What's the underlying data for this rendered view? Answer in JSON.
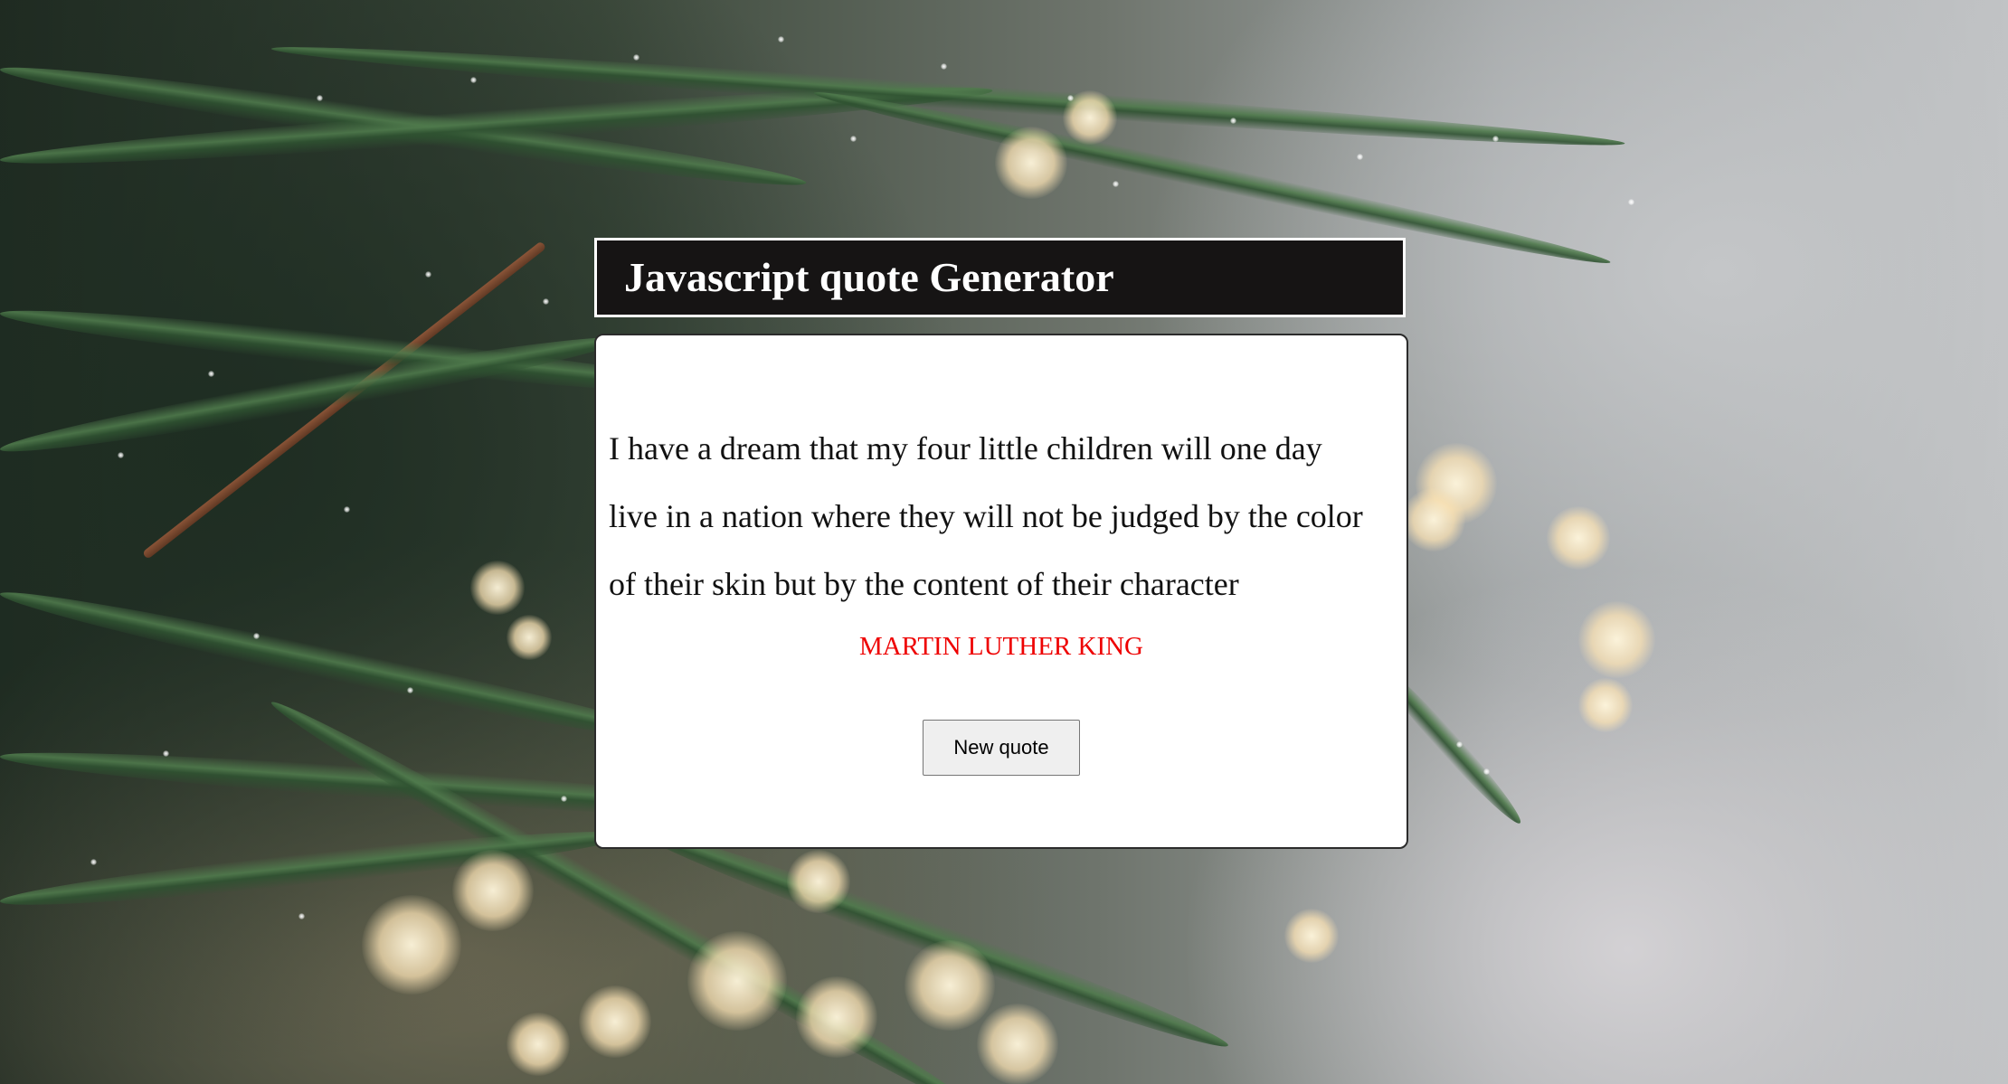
{
  "header": {
    "title": "Javascript quote Generator"
  },
  "quote": {
    "text": "I have a dream that my four little children will one day live in a nation where they will not be judged by the color of their skin but by the content of their character",
    "author": "MARTIN LUTHER KING"
  },
  "actions": {
    "new_quote_label": "New quote"
  },
  "colors": {
    "header_background": "#161414",
    "author_text": "#ee0000",
    "card_background": "#ffffff",
    "button_background": "#efefef"
  }
}
